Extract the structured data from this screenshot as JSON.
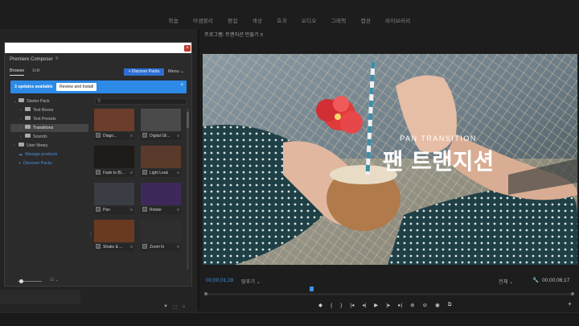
{
  "workspaces": [
    "학습",
    "어셈블리",
    "편집",
    "색상",
    "효과",
    "오디오",
    "그래픽",
    "캡션",
    "라이브러리"
  ],
  "composer": {
    "title": "Premiere Composer",
    "menu_icon": "≡",
    "tabs": [
      "Browse",
      "Edit"
    ],
    "active_tab": "Browse",
    "discover_button": "+ Discover Packs",
    "menu_label": "Menu ⌄",
    "update_text": "3 updates available",
    "review_button": "Review and Install",
    "close_icon": "×",
    "tree": [
      {
        "label": "Starter Pack",
        "chev": "⌄",
        "indent": 0,
        "folder": true
      },
      {
        "label": "Text Boxes",
        "chev": "›",
        "indent": 1,
        "folder": true
      },
      {
        "label": "Text Presets",
        "chev": "›",
        "indent": 1,
        "folder": true
      },
      {
        "label": "Transitions",
        "chev": "›",
        "indent": 1,
        "folder": true,
        "selected": true
      },
      {
        "label": "Sounds",
        "chev": "›",
        "indent": 1,
        "folder": true
      },
      {
        "label": "User library",
        "chev": "›",
        "indent": 0,
        "folder": true
      },
      {
        "label": "Manage products",
        "chev": "",
        "indent": 0,
        "link": true,
        "icon": "☁"
      },
      {
        "label": "Discover Packs",
        "chev": "",
        "indent": 0,
        "link": true,
        "icon": "+"
      }
    ],
    "items": [
      {
        "label": "Diago...",
        "color": "#6b3d2a"
      },
      {
        "label": "Digital Gli...",
        "color": "#4a4a4a"
      },
      {
        "label": "Fade to Bl...",
        "color": "#1e1a18"
      },
      {
        "label": "Light Leak",
        "color": "#5a3a2a"
      },
      {
        "label": "Pan",
        "color": "#3a3d44"
      },
      {
        "label": "Rotate",
        "color": "#3d2a5a"
      },
      {
        "label": "Shake & ...",
        "color": "#6a3a20"
      },
      {
        "label": "Zoom In",
        "color": "#2e2e2e"
      },
      {
        "label": "",
        "color": "#2b2b2b"
      }
    ],
    "view_toggle": "☷ ⌄"
  },
  "program": {
    "title": "프로그램: 트랜지션 만들기 ≡",
    "overlay_small": "PAN TRANSITION",
    "overlay_large": "팬 트랜지션",
    "timecode_left": "00;00;01;28",
    "fit": "맞추기 ⌄",
    "full": "전체 ⌄",
    "timecode_right": "00;00;06;17",
    "transport": [
      "◆",
      "{",
      "}",
      "|◂",
      "◂|",
      "▶",
      "|▸",
      "▸|",
      "⊕",
      "⊖",
      "◉",
      "⧉"
    ],
    "add": "+"
  },
  "bottom_tools": [
    "▼",
    "⬚",
    "⌂"
  ]
}
